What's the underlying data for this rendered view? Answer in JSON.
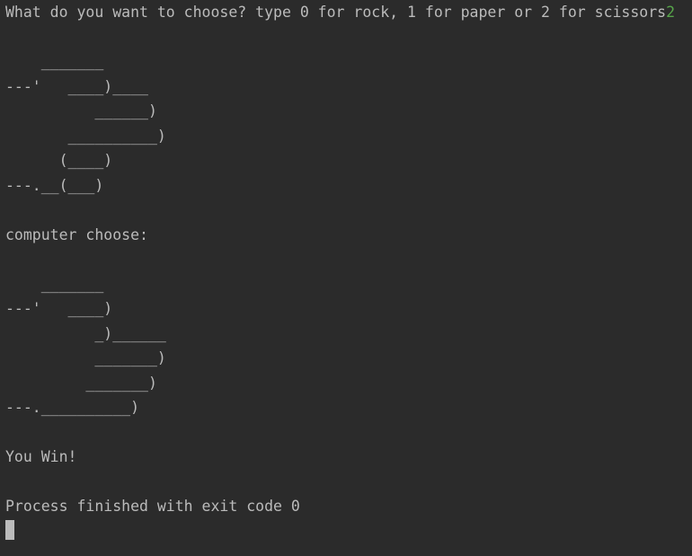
{
  "console": {
    "prompt": "What do you want to choose? type 0 for rock, 1 for paper or 2 for scissors",
    "user_input": "2",
    "player_art": [
      "    _______",
      "---'   ____)____",
      "          ______)",
      "       __________)",
      "      (____)",
      "---.__(___)"
    ],
    "computer_label": "computer choose:",
    "computer_art": [
      "    _______",
      "---'   ____)",
      "          _)______",
      "          _______)",
      "         _______)",
      "---.__________)"
    ],
    "result": "You Win!",
    "exit_message": "Process finished with exit code 0"
  }
}
